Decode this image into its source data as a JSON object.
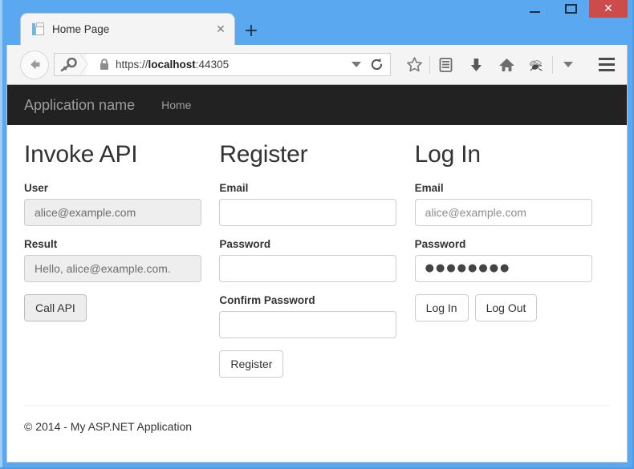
{
  "window": {
    "minimize_label": "—",
    "maximize_label": "",
    "close_label": "✕"
  },
  "browser": {
    "tab": {
      "title": "Home Page",
      "close_label": "✕",
      "favicon": "page-icon"
    },
    "new_tab_label": "+",
    "url": {
      "scheme": "https://",
      "host": "localhost",
      "port": ":44305",
      "full": "https://localhost:44305"
    },
    "icons": {
      "back": "back-arrow-icon",
      "identity": "key-icon",
      "lock": "padlock-icon",
      "autocomplete": "chevron-down-icon",
      "reload": "reload-icon",
      "bookmark": "star-icon",
      "reader": "reader-list-icon",
      "downloads": "download-arrow-icon",
      "home": "home-icon",
      "addon": "bee-icon",
      "overflow": "chevron-down-icon",
      "menu": "hamburger-menu-icon"
    }
  },
  "site": {
    "brand": "Application name",
    "nav": [
      {
        "label": "Home"
      }
    ],
    "columns": [
      {
        "id": "invoke-api",
        "title": "Invoke API",
        "fields": [
          {
            "id": "user",
            "label": "User",
            "value": "alice@example.com",
            "placeholder": "",
            "disabled": true,
            "type": "text"
          },
          {
            "id": "result",
            "label": "Result",
            "value": "Hello, alice@example.com.",
            "placeholder": "",
            "disabled": true,
            "type": "text"
          }
        ],
        "buttons": [
          {
            "id": "call-api",
            "label": "Call API",
            "style": "grey"
          }
        ]
      },
      {
        "id": "register",
        "title": "Register",
        "fields": [
          {
            "id": "register-email",
            "label": "Email",
            "value": "",
            "placeholder": "",
            "disabled": false,
            "type": "text"
          },
          {
            "id": "register-password",
            "label": "Password",
            "value": "",
            "placeholder": "",
            "disabled": false,
            "type": "password"
          },
          {
            "id": "register-confirm-password",
            "label": "Confirm Password",
            "value": "",
            "placeholder": "",
            "disabled": false,
            "type": "password"
          }
        ],
        "buttons": [
          {
            "id": "register",
            "label": "Register",
            "style": "default"
          }
        ]
      },
      {
        "id": "log-in",
        "title": "Log In",
        "fields": [
          {
            "id": "login-email",
            "label": "Email",
            "value": "alice@example.com",
            "placeholder": "",
            "disabled": false,
            "type": "text"
          },
          {
            "id": "login-password",
            "label": "Password",
            "value": "●●●●●●●●",
            "placeholder": "",
            "disabled": false,
            "type": "password"
          }
        ],
        "buttons": [
          {
            "id": "log-in",
            "label": "Log In",
            "style": "default"
          },
          {
            "id": "log-out",
            "label": "Log Out",
            "style": "default"
          }
        ]
      }
    ],
    "footer": "© 2014 - My ASP.NET Application"
  },
  "colors": {
    "window_chrome": "#5aa9f0",
    "close_button": "#cc4b4b",
    "navbar": "#222222",
    "navbar_text": "#9d9d9d",
    "input_disabled_bg": "#eeeeee"
  }
}
